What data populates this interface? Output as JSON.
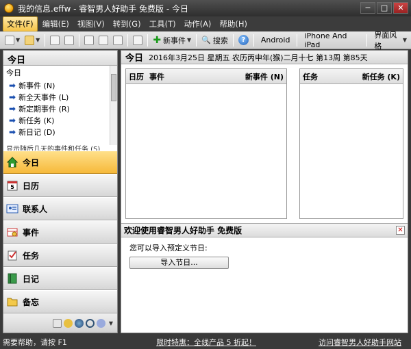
{
  "window": {
    "title": "我的信息.effw - 睿智男人好助手 免费版 - 今日",
    "min": "−",
    "max": "□",
    "close": "✕"
  },
  "menubar": {
    "items": [
      "文件(F)",
      "编辑(E)",
      "视图(V)",
      "转到(G)",
      "工具(T)",
      "动作(A)",
      "帮助(H)"
    ],
    "active_index": 0
  },
  "toolbar": {
    "new_event": "新事件",
    "search": "搜索",
    "android": "Android",
    "iphone": "iPhone And iPad",
    "skin": "界面风格"
  },
  "left": {
    "header": "今日",
    "list_caption": "今日",
    "list": [
      "新事件 (N)",
      "新全天事件 (L)",
      "新定期事件 (R)",
      "新任务 (K)",
      "新日记 (D)"
    ],
    "cut_text": "显示随后几天的事件和任务 (S)",
    "nav": [
      {
        "label": "今日",
        "icon": "home-icon"
      },
      {
        "label": "日历",
        "icon": "calendar-icon"
      },
      {
        "label": "联系人",
        "icon": "contacts-icon"
      },
      {
        "label": "事件",
        "icon": "event-icon"
      },
      {
        "label": "任务",
        "icon": "task-icon"
      },
      {
        "label": "日记",
        "icon": "diary-icon"
      },
      {
        "label": "备忘",
        "icon": "memo-icon"
      }
    ]
  },
  "main": {
    "today_label": "今日",
    "date_text": "2016年3月25日 星期五 农历丙申年(猴)二月十七 第13周 第85天",
    "calendar_panel": {
      "col1": "日历",
      "col2": "事件",
      "action": "新事件 (N)"
    },
    "task_panel": {
      "col1": "任务",
      "action": "新任务 (K)"
    },
    "welcome": {
      "title": "欢迎使用睿智男人好助手 免费版",
      "text": "您可以导入预定义节日:",
      "button": "导入节日..."
    }
  },
  "status": {
    "left": "需要帮助，请按 F1",
    "middle": "限时特惠：全线产品 5 折起！",
    "right": "访问睿智男人好助手网站"
  },
  "colors": {
    "accent_orange": "#f6b93a",
    "chrome_dark": "#3a3a3a"
  }
}
